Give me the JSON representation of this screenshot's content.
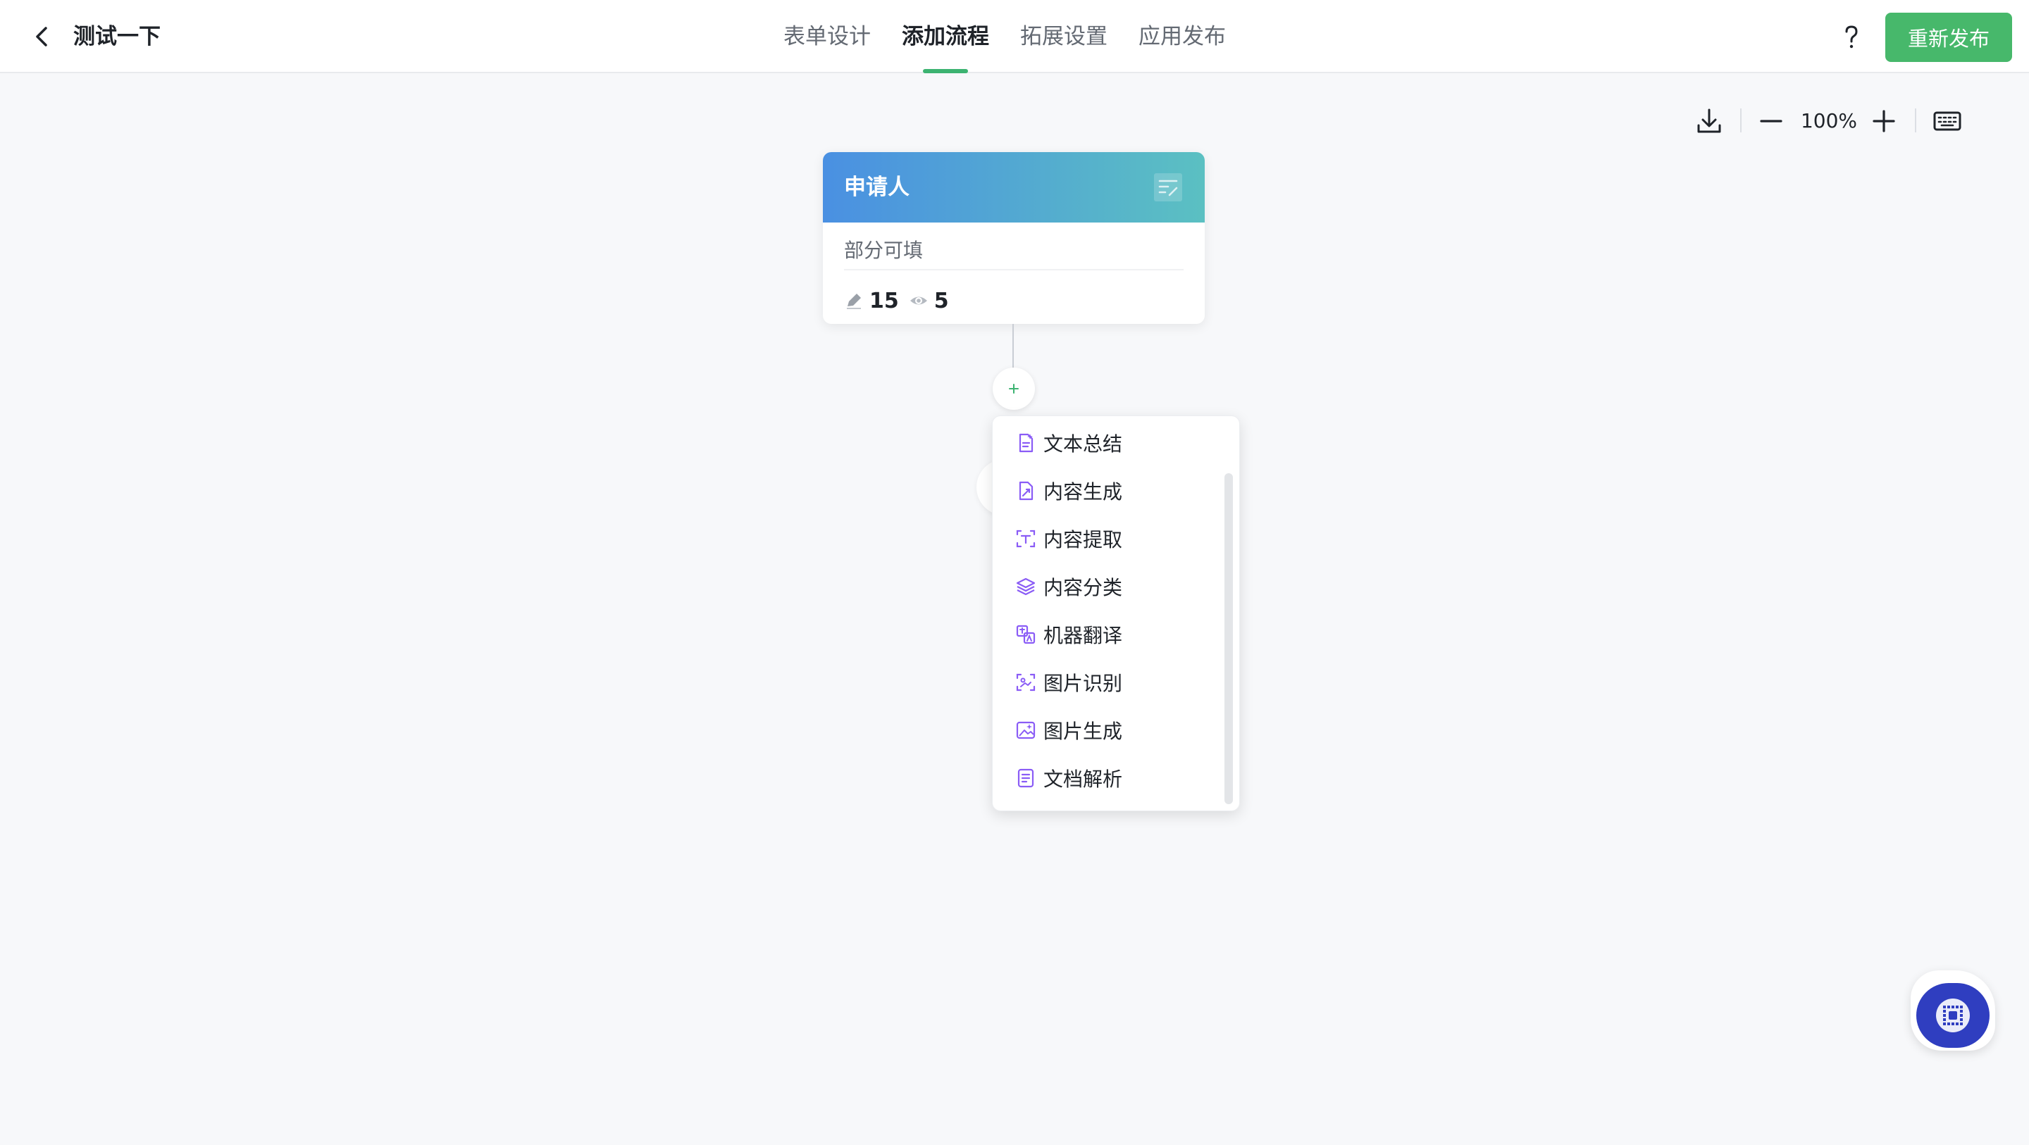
{
  "header": {
    "title": "测试一下",
    "tabs": [
      {
        "label": "表单设计",
        "active": false
      },
      {
        "label": "添加流程",
        "active": true
      },
      {
        "label": "拓展设置",
        "active": false
      },
      {
        "label": "应用发布",
        "active": false
      }
    ],
    "publish_label": "重新发布",
    "accent_color": "#47b86b"
  },
  "toolbar": {
    "zoom": "100%",
    "icons": [
      "download-icon",
      "zoom-out-icon",
      "zoom-in-icon",
      "keyboard-icon"
    ]
  },
  "node": {
    "title": "申请人",
    "subtitle": "部分可填",
    "editable_count": "15",
    "visible_count": "5",
    "header_gradient": [
      "#4a90e2",
      "#5bc0c2"
    ]
  },
  "menu": {
    "icon_color": "#8a5cf6",
    "items": [
      {
        "label": "文本总结",
        "icon": "text-summary-icon"
      },
      {
        "label": "内容生成",
        "icon": "content-generate-icon"
      },
      {
        "label": "内容提取",
        "icon": "content-extract-icon"
      },
      {
        "label": "内容分类",
        "icon": "layers-icon"
      },
      {
        "label": "机器翻译",
        "icon": "translate-icon"
      },
      {
        "label": "图片识别",
        "icon": "image-recognition-icon"
      },
      {
        "label": "图片生成",
        "icon": "image-generate-icon"
      },
      {
        "label": "文档解析",
        "icon": "document-parse-icon"
      }
    ]
  }
}
